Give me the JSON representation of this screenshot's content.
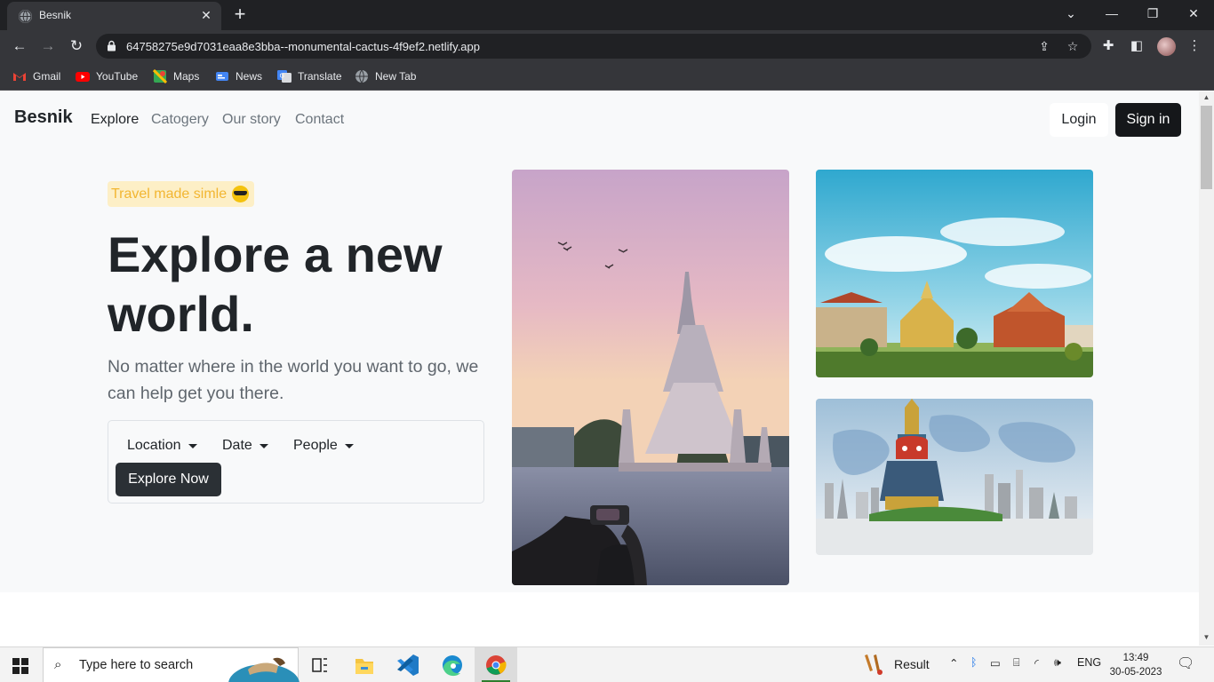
{
  "browser": {
    "tab_title": "Besnik",
    "url": "64758275e9d7031eaa8e3bba--monumental-cactus-4f9ef2.netlify.app",
    "bookmarks": [
      {
        "label": "Gmail",
        "icon": "gmail-icon"
      },
      {
        "label": "YouTube",
        "icon": "youtube-icon"
      },
      {
        "label": "Maps",
        "icon": "maps-icon"
      },
      {
        "label": "News",
        "icon": "news-icon"
      },
      {
        "label": "Translate",
        "icon": "translate-icon"
      },
      {
        "label": "New Tab",
        "icon": "globe-icon"
      }
    ]
  },
  "site": {
    "brand": "Besnik",
    "nav": [
      "Explore",
      "Catogery",
      "Our story",
      "Contact"
    ],
    "login": "Login",
    "signin": "Sign in",
    "badge": "Travel made simle",
    "headline": "Explore a new world.",
    "lead": "No matter where in the world you want to go, we can help get you there.",
    "dropdowns": [
      "Location",
      "Date",
      "People"
    ],
    "explore_button": "Explore Now",
    "colors": {
      "badge_text": "#f2b632",
      "badge_bg": "#fdefc6",
      "dark_button": "#15171a"
    }
  },
  "taskbar": {
    "search_placeholder": "Type here to search",
    "pinned": [
      "task-view-icon",
      "file-explorer-icon",
      "vscode-icon",
      "edge-icon",
      "chrome-icon"
    ],
    "result_label": "Result",
    "language": "ENG",
    "time": "13:49",
    "date": "30-05-2023"
  }
}
